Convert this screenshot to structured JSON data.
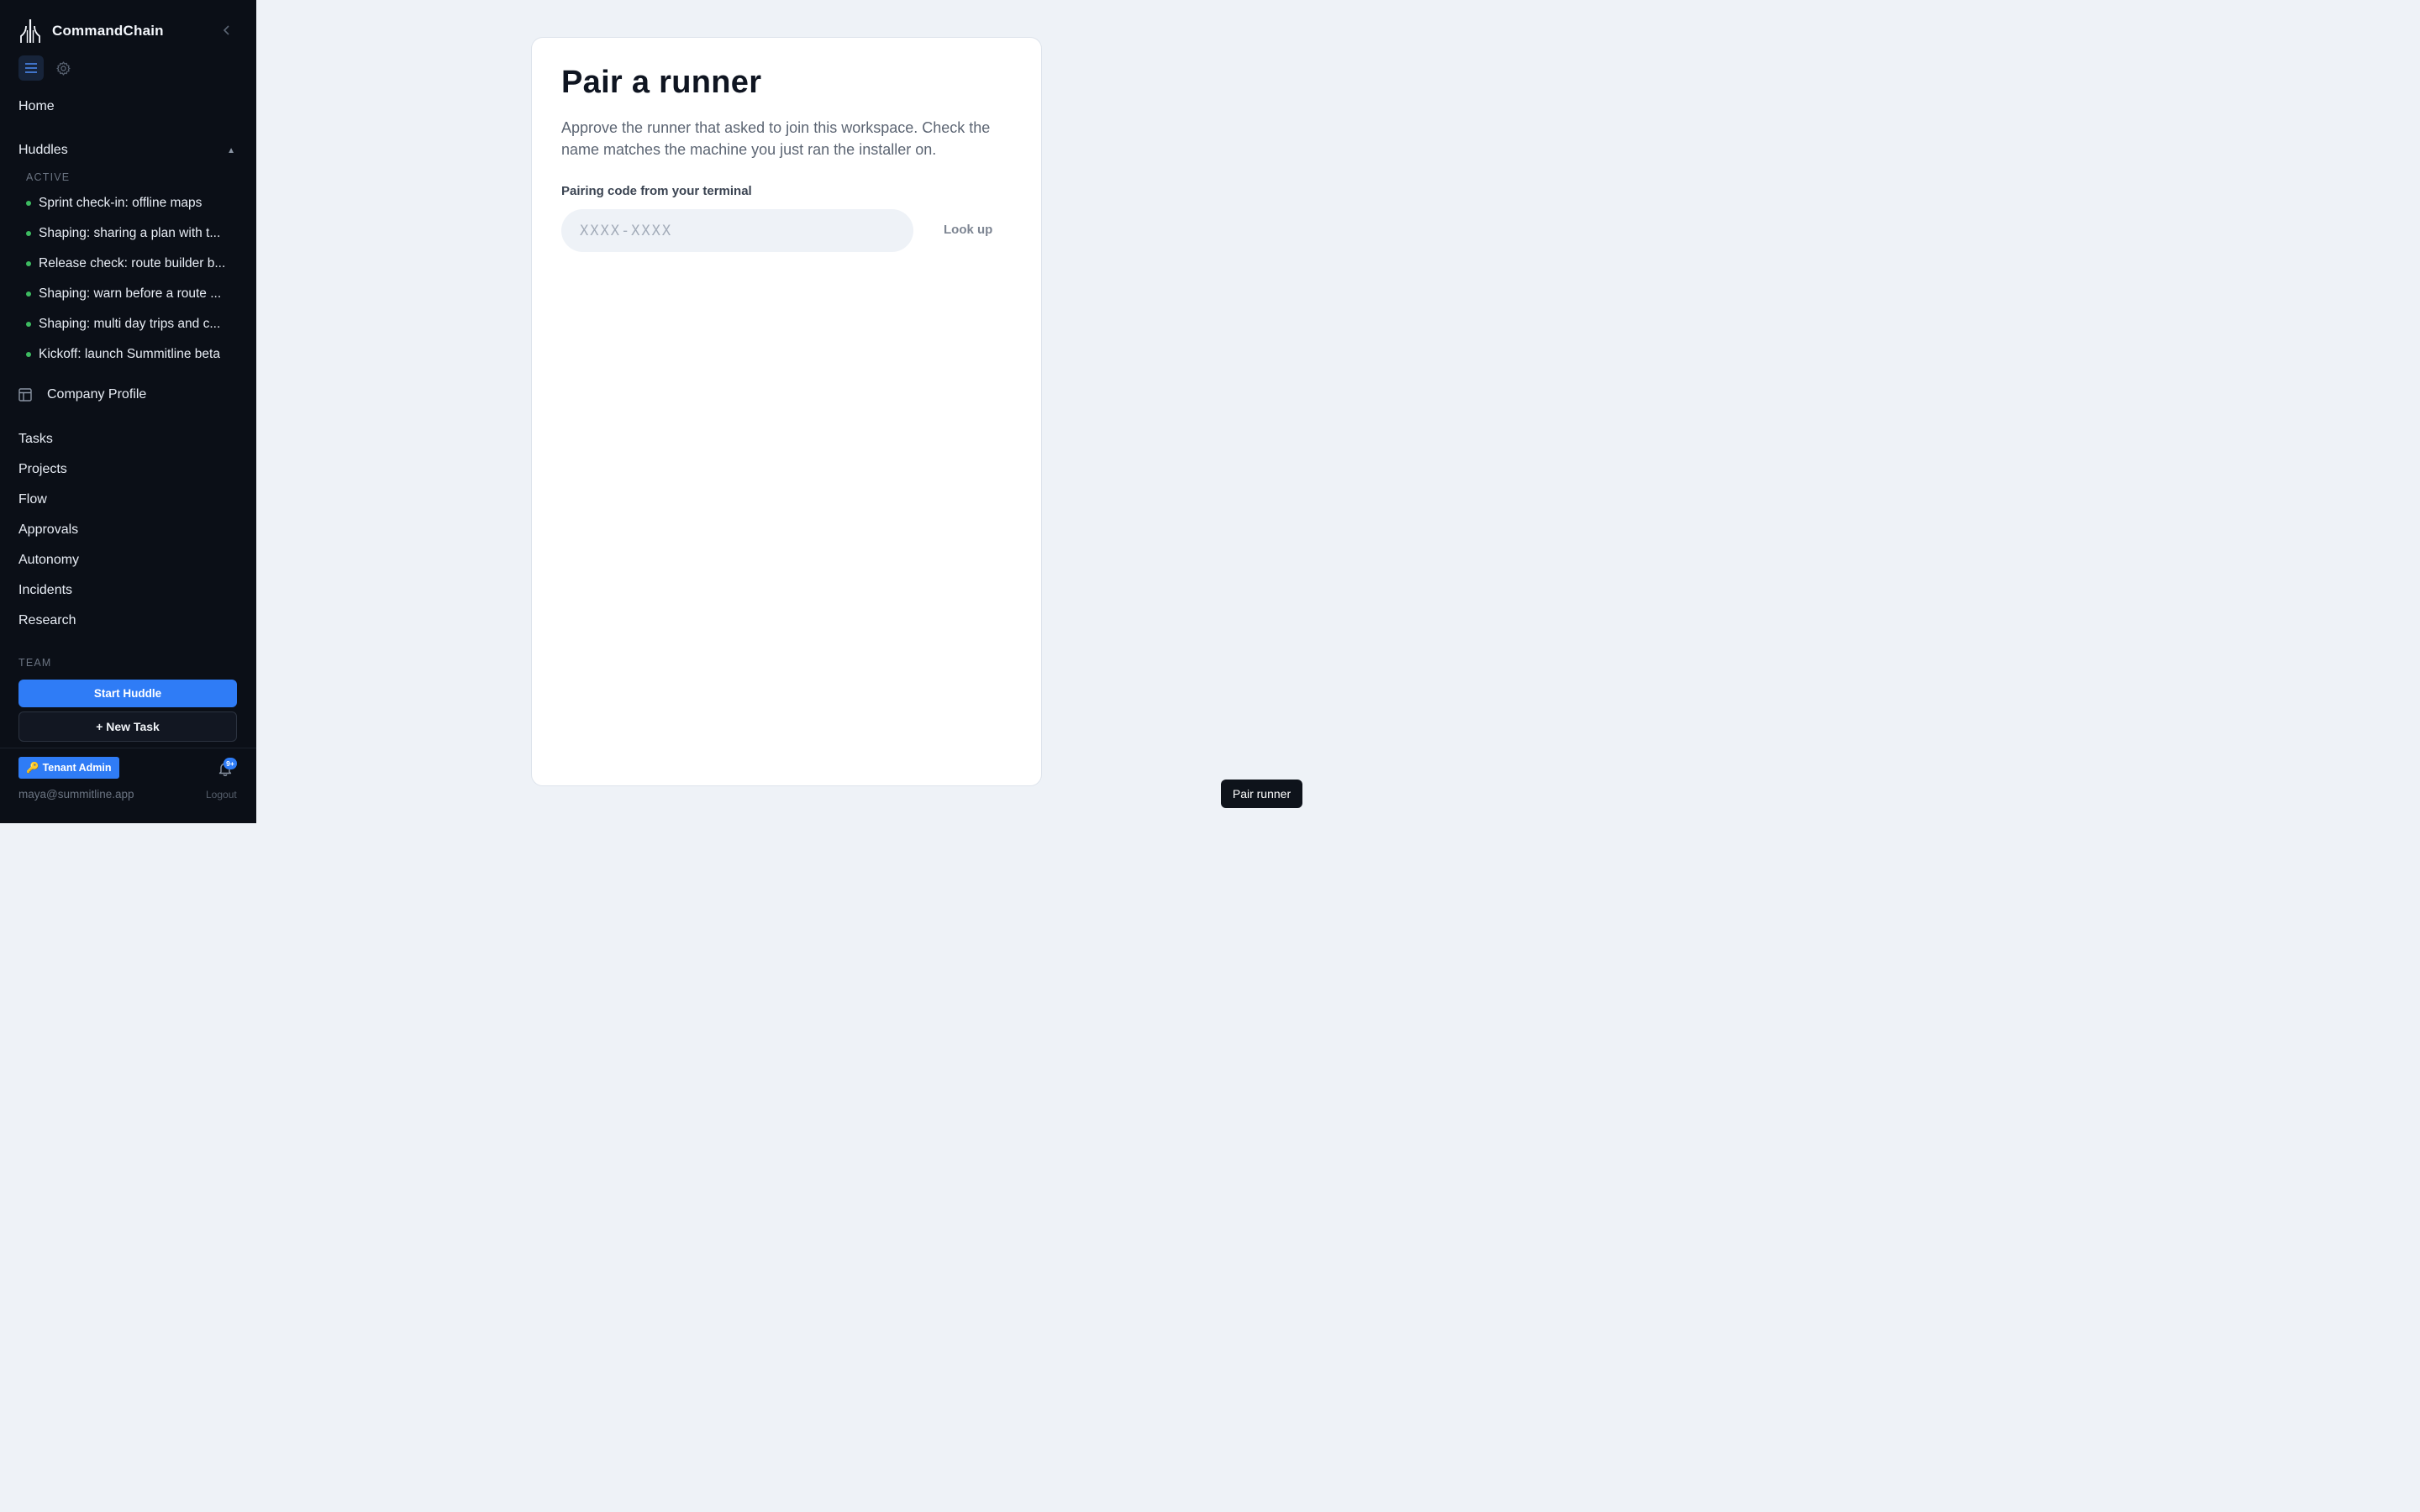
{
  "app": {
    "name": "CommandChain"
  },
  "nav": {
    "home": "Home",
    "huddles": {
      "label": "Huddles",
      "active_label": "ACTIVE",
      "items": [
        "Sprint check-in: offline maps",
        "Shaping: sharing a plan with t...",
        "Release check: route builder b...",
        "Shaping: warn before a route ...",
        "Shaping: multi day trips and c...",
        "Kickoff: launch Summitline beta"
      ]
    },
    "company_profile": "Company Profile",
    "links": [
      "Tasks",
      "Projects",
      "Flow",
      "Approvals",
      "Autonomy",
      "Incidents",
      "Research"
    ],
    "team_label": "TEAM",
    "start_huddle": "Start Huddle",
    "new_task": "+ New Task"
  },
  "footer": {
    "role_badge_icon": "🔑",
    "role_badge": "Tenant Admin",
    "notifications": "9+",
    "email": "maya@summitline.app",
    "logout": "Logout"
  },
  "main": {
    "title": "Pair a runner",
    "description": "Approve the runner that asked to join this workspace. Check the name matches the machine you just ran the installer on.",
    "field_label": "Pairing code from your terminal",
    "code_value": "",
    "code_placeholder": "XXXX-XXXX",
    "lookup": "Look up"
  },
  "toast": {
    "label": "Pair runner"
  },
  "colors": {
    "accent": "#2f7cf6",
    "sidebar_bg": "#0b0f17",
    "active_dot": "#3dbb61",
    "page_bg": "#eef2f7"
  }
}
